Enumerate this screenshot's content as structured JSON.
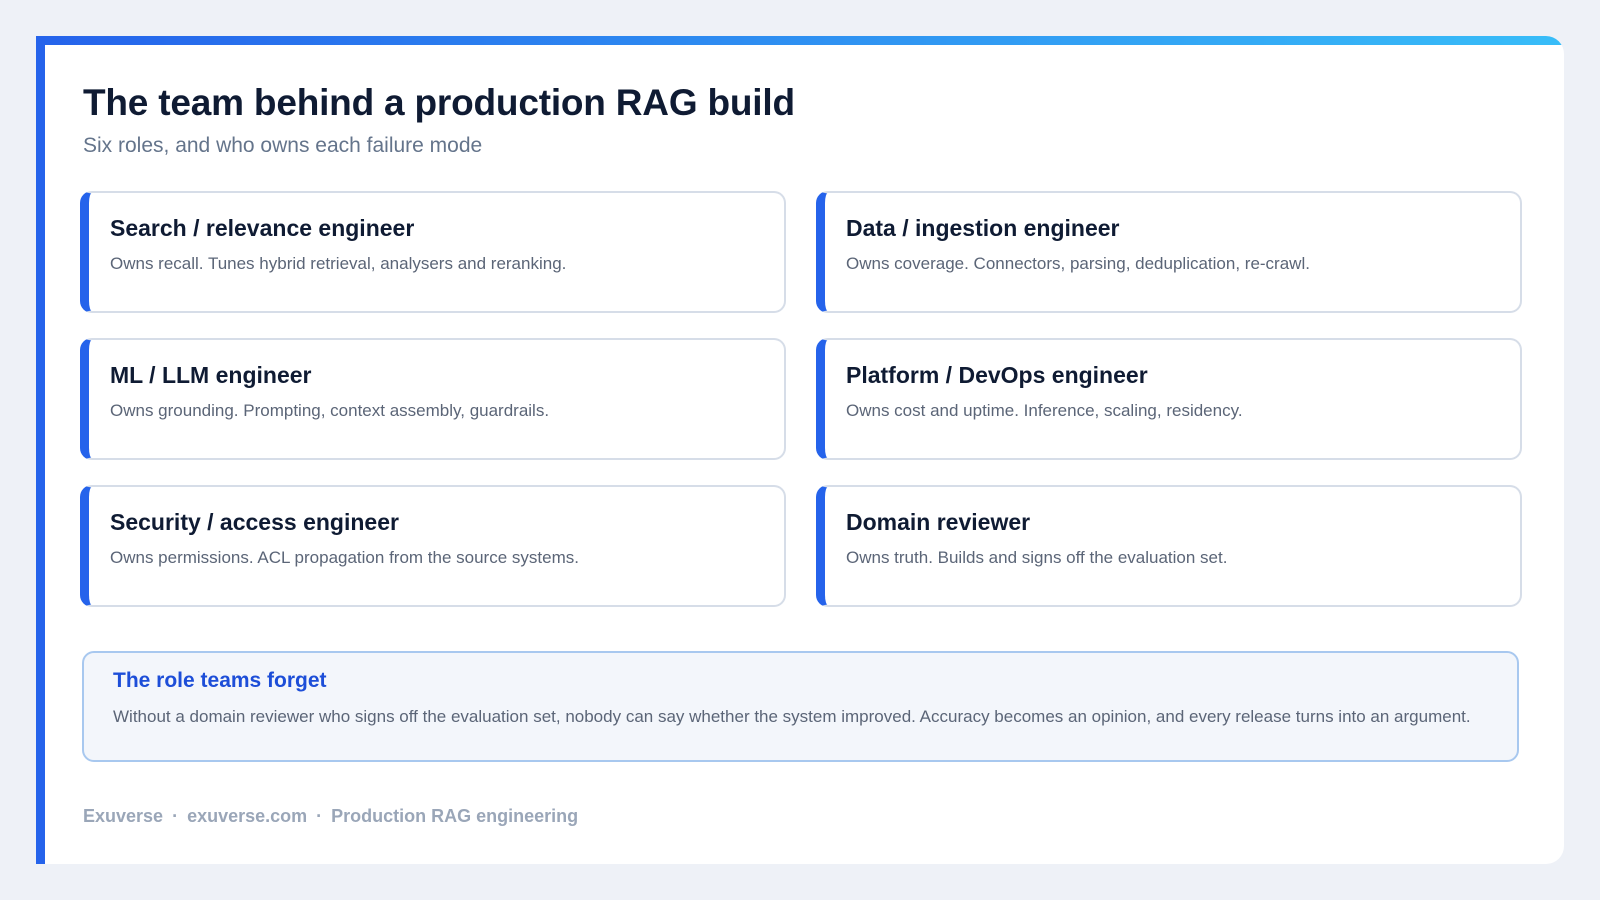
{
  "slide": {
    "title": "The team behind a production RAG build",
    "subtitle": "Six roles, and who owns each failure mode"
  },
  "roles": [
    {
      "title": "Search / relevance engineer",
      "description": "Owns recall. Tunes hybrid retrieval, analysers and reranking."
    },
    {
      "title": "Data / ingestion engineer",
      "description": "Owns coverage. Connectors, parsing, deduplication, re-crawl."
    },
    {
      "title": "ML / LLM engineer",
      "description": "Owns grounding. Prompting, context assembly, guardrails."
    },
    {
      "title": "Platform / DevOps engineer",
      "description": "Owns cost and uptime. Inference, scaling, residency."
    },
    {
      "title": "Security / access engineer",
      "description": "Owns permissions. ACL propagation from the source systems."
    },
    {
      "title": "Domain reviewer",
      "description": "Owns truth. Builds and signs off the evaluation set."
    }
  ],
  "callout": {
    "title": "The role teams forget",
    "body": "Without a domain reviewer who signs off the evaluation set, nobody can say whether the system improved. Accuracy becomes an opinion, and every release turns into an argument."
  },
  "footer": {
    "brand": "Exuverse",
    "separator": "·",
    "site": "exuverse.com",
    "topic": "Production RAG engineering"
  },
  "colors": {
    "accent": "#2563eb",
    "accent_light": "#38bdf8",
    "title": "#0f1b33",
    "muted": "#64748b",
    "callout_title": "#1d4ed8",
    "background": "#eef1f7"
  }
}
